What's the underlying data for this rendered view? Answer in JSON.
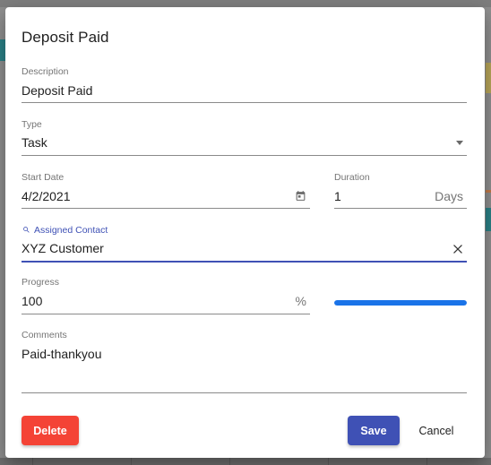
{
  "dialog": {
    "title": "Deposit Paid"
  },
  "fields": {
    "description": {
      "label": "Description",
      "value": "Deposit Paid"
    },
    "type": {
      "label": "Type",
      "value": "Task"
    },
    "start_date": {
      "label": "Start Date",
      "value": "4/2/2021"
    },
    "duration": {
      "label": "Duration",
      "value": "1",
      "unit": "Days"
    },
    "assigned_contact": {
      "label": "Assigned Contact",
      "value": "XYZ Customer"
    },
    "progress": {
      "label": "Progress",
      "value": "100",
      "unit": "%",
      "bar_fraction": 1.0
    },
    "comments": {
      "label": "Comments",
      "value": "Paid-thankyou"
    }
  },
  "buttons": {
    "delete": "Delete",
    "save": "Save",
    "cancel": "Cancel"
  },
  "icons": {
    "dropdown": "chevron-down-icon",
    "calendar": "calendar-icon",
    "search": "search-icon",
    "clear": "close-icon"
  },
  "colors": {
    "primary": "#3f51b5",
    "danger": "#f44336",
    "progress": "#1a73e8",
    "progress_track": "#cfe3fb"
  }
}
